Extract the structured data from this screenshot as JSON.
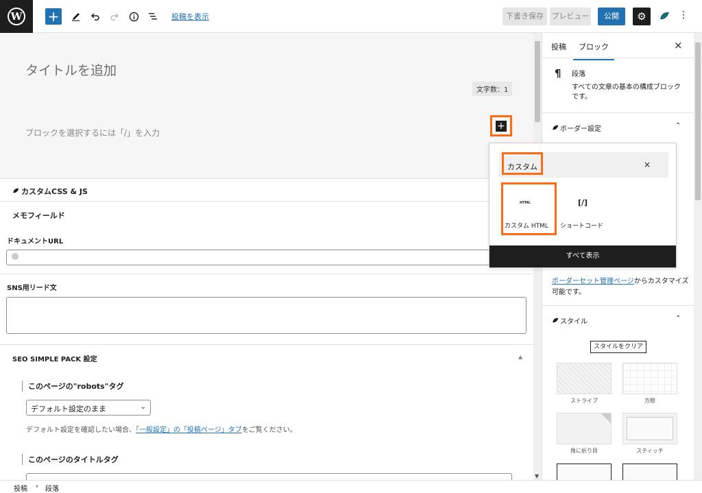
{
  "topbar": {
    "logo_letter": "W",
    "add_block_symbol": "+",
    "tools": [
      "pencil-icon",
      "undo-icon",
      "redo-icon",
      "info-icon",
      "list-view-icon"
    ],
    "show_post_link": "投稿を表示",
    "save_draft_label": "下書き保存",
    "preview_label": "プレビュー",
    "publish_label": "公開",
    "accent_color": "#2271b1"
  },
  "editor": {
    "title_placeholder": "タイトルを追加",
    "char_count": "文字数：1",
    "block_placeholder": "ブロックを選択するには「/」を入力",
    "inserter_symbol": "+",
    "custom_css_js": "カスタムCSS & JS",
    "memo_field": "メモフィールド",
    "document_url_label": "ドキュメントURL",
    "sns_lead_label": "SNS用リード文",
    "seo_section": "SEO SIMPLE PACK 設定",
    "robots_heading": "このページの\"robots\"タグ",
    "robots_select_value": "デフォルト設定のまま",
    "help_prefix": "デフォルト設定を確認したい場合、",
    "help_link": "「一般設定」の「投稿ページ」タブ",
    "help_suffix": "をご覧ください。",
    "title_tag_heading": "このページのタイトルタグ"
  },
  "popover": {
    "search_value": "カスタム",
    "clear_symbol": "×",
    "results": [
      {
        "icon_text": "HTML",
        "label": "カスタム HTML"
      },
      {
        "icon_text": "[/]",
        "label": "ショートコード"
      }
    ],
    "show_all_label": "すべて表示",
    "highlight_color": "#ff6a13"
  },
  "sidebar": {
    "tabs": [
      "投稿",
      "ブロック"
    ],
    "active_tab": "ブロック",
    "close_symbol": "×",
    "block_icon": "¶",
    "block_name": "段落",
    "block_desc": "すべての文章の基本の構成ブロックです。",
    "border_panel": "ボーダー設定",
    "border_link_text": "ボーダーセット管理ページ",
    "border_link_suffix": "からカスタマイズ可能です。",
    "style_panel": "スタイル",
    "clear_style_label": "スタイルをクリア",
    "styles": [
      "ストライプ",
      "方眼",
      "角に折り目",
      "スティッチ"
    ]
  },
  "footer": {
    "breadcrumb": [
      "投稿",
      "段落"
    ],
    "separator": "›"
  }
}
